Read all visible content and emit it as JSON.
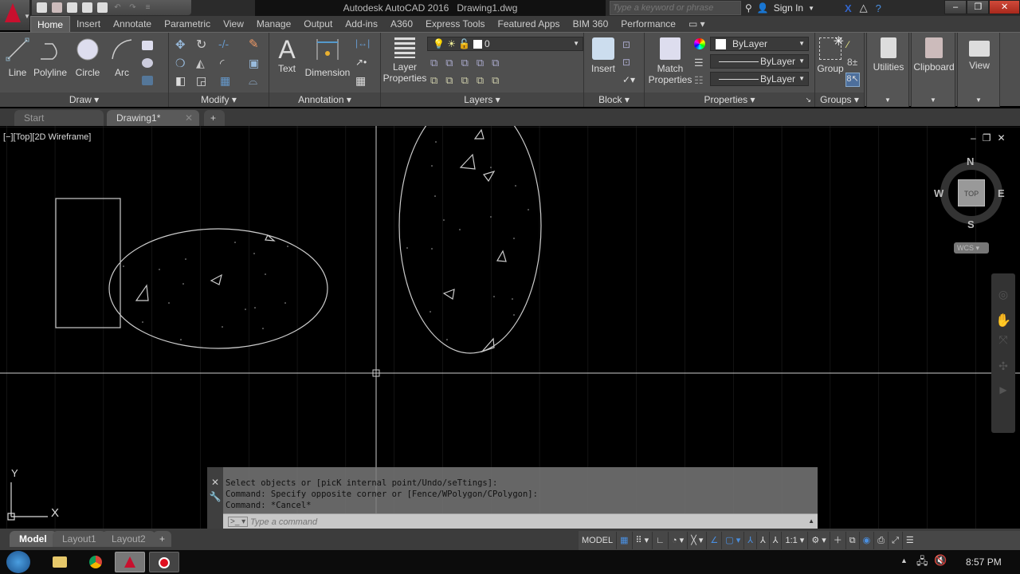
{
  "titlebar": {
    "title": "Autodesk AutoCAD 2016",
    "filename": "Drawing1.dwg",
    "search_placeholder": "Type a keyword or phrase",
    "sign_in": "Sign In",
    "qat_icons": [
      "new-icon",
      "open-icon",
      "save-icon",
      "save-as-icon",
      "plot-icon",
      "undo-icon",
      "redo-icon",
      "customize-icon"
    ]
  },
  "ribbon_tabs": [
    "Home",
    "Insert",
    "Annotate",
    "Parametric",
    "View",
    "Manage",
    "Output",
    "Add-ins",
    "A360",
    "Express Tools",
    "Featured Apps",
    "BIM 360",
    "Performance"
  ],
  "ribbon": {
    "draw": {
      "title": "Draw",
      "line": "Line",
      "polyline": "Polyline",
      "circle": "Circle",
      "arc": "Arc"
    },
    "modify": {
      "title": "Modify"
    },
    "annotation": {
      "title": "Annotation",
      "text": "Text",
      "dimension": "Dimension"
    },
    "layers": {
      "title": "Layers",
      "layer_properties_1": "Layer",
      "layer_properties_2": "Properties",
      "current_layer": "0"
    },
    "block": {
      "title": "Block",
      "insert": "Insert"
    },
    "properties": {
      "title": "Properties",
      "match_1": "Match",
      "match_2": "Properties",
      "color": "ByLayer",
      "lineweight": "ByLayer",
      "linetype": "ByLayer"
    },
    "groups": {
      "title": "Groups",
      "group": "Group"
    },
    "utilities": "Utilities",
    "clipboard": "Clipboard",
    "view": "View"
  },
  "doc_tabs": {
    "start": "Start",
    "drawing": "Drawing1*",
    "add": "+"
  },
  "viewport": {
    "label": "[−][Top][2D Wireframe]",
    "viewcube": {
      "n": "N",
      "s": "S",
      "e": "E",
      "w": "W",
      "face": "TOP",
      "ucs": "WCS"
    },
    "ucs_x": "X",
    "ucs_y": "Y"
  },
  "command": {
    "history": [
      "Select objects or [picK internal point/Undo/seTtings]:",
      "Command: Specify opposite corner or [Fence/WPolygon/CPolygon]:",
      "Command: *Cancel*"
    ],
    "placeholder": "Type a command"
  },
  "layout_tabs": [
    "Model",
    "Layout1",
    "Layout2",
    "+"
  ],
  "status": {
    "model": "MODEL",
    "scale": "1:1"
  },
  "taskbar": {
    "time": "8:57 PM"
  }
}
